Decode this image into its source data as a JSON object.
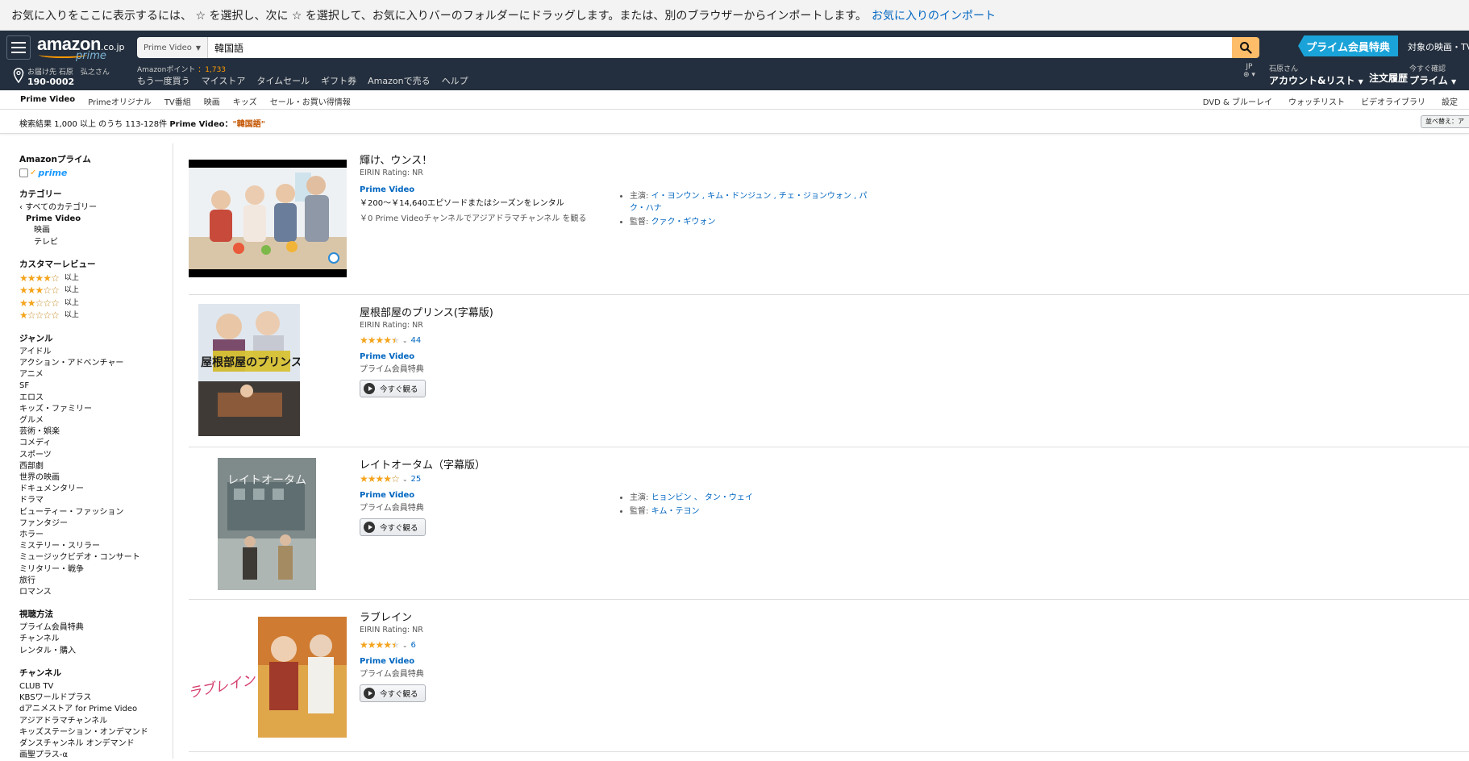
{
  "favorites_bar": {
    "message": "お気に入りをここに表示するには、 ☆ を選択し、次に ☆ を選択して、お気に入りバーのフォルダーにドラッグします。または、別のブラウザーからインポートします。",
    "import_link": "お気に入りのインポート"
  },
  "header": {
    "logo_text": "amazon",
    "logo_suffix": ".co.jp",
    "logo_prime": "prime",
    "search_category": "Prime Video",
    "search_value": "韓国語",
    "prime_banner": "プライム会員特典",
    "prime_banner_text": "対象の映画・TV",
    "deliver_line1": "お届け先 石原　弘之さん",
    "deliver_line2": "190-0002",
    "points_label": "Amazonポイント",
    "points_value": "：1,733",
    "nav_links": [
      "もう一度買う",
      "マイストア",
      "タイムセール",
      "ギフト券",
      "Amazonで売る",
      "ヘルプ"
    ],
    "lang": "JP",
    "account_line1": "石原さん",
    "account_line2": "アカウント&リスト",
    "orders": "注文履歴",
    "prime_line1": "今すぐ確認",
    "prime_line2": "プライム"
  },
  "subnav": {
    "left": [
      "Prime Video",
      "Primeオリジナル",
      "TV番組",
      "映画",
      "キッズ",
      "セール・お買い得情報"
    ],
    "right": [
      "DVD & ブルーレイ",
      "ウォッチリスト",
      "ビデオライブラリ",
      "設定"
    ]
  },
  "results_bar": {
    "prefix": "検索結果 1,000 以上 のうち 113-128件",
    "category": "Prime Video",
    "sep": "：",
    "query": "\"韓国語\"",
    "sort_label": "並べ替え：ア"
  },
  "sidebar": {
    "prime_head": "Amazonプライム",
    "prime_logo": "prime",
    "category_head": "カテゴリー",
    "all_categories": "すべてのカテゴリー",
    "prime_video": "Prime Video",
    "movie": "映画",
    "tv": "テレビ",
    "review_head": "カスタマーレビュー",
    "review_suffix": "以上",
    "review_levels": [
      4,
      3,
      2,
      1
    ],
    "genre_head": "ジャンル",
    "genres": [
      "アイドル",
      "アクション・アドベンチャー",
      "アニメ",
      "SF",
      "エロス",
      "キッズ・ファミリー",
      "グルメ",
      "芸術・娯楽",
      "コメディ",
      "スポーツ",
      "西部劇",
      "世界の映画",
      "ドキュメンタリー",
      "ドラマ",
      "ビューティー・ファッション",
      "ファンタジー",
      "ホラー",
      "ミステリー・スリラー",
      "ミュージックビデオ・コンサート",
      "ミリタリー・戦争",
      "旅行",
      "ロマンス"
    ],
    "viewing_head": "視聴方法",
    "viewing": [
      "プライム会員特典",
      "チャンネル",
      "レンタル・購入"
    ],
    "channel_head": "チャンネル",
    "channels": [
      "CLUB TV",
      "KBSワールドプラス",
      "dアニメストア for Prime Video",
      "アジアドラマチャンネル",
      "キッズステーション・オンデマンド",
      "ダンスチャンネル オンデマンド",
      "画聖プラス-α"
    ]
  },
  "results": [
    {
      "title": "輝け、ウンス！",
      "rating_label": "EIRIN Rating: NR",
      "pv": "Prime Video",
      "rent": "￥200～￥14,640エピソードまたはシーズンをレンタル",
      "channel": "￥0 Prime Videoチャンネルでアジアドラマチャンネル を観る",
      "cast_label": "主演: ",
      "cast": "イ・ヨンウン , キム・ドンジュン , チェ・ジョンウォン , パク・ハナ",
      "director_label": "監督: ",
      "director": "クァク・ギウォン"
    },
    {
      "title": "屋根部屋のプリンス(字幕版)",
      "rating_label": "EIRIN Rating: NR",
      "stars": 4.5,
      "count": "44",
      "pv": "Prime Video",
      "member": "プライム会員特典",
      "watch": "今すぐ観る",
      "poster_text": "屋根部屋のプリンス"
    },
    {
      "title": "レイトオータム（字幕版）",
      "stars": 4,
      "count": "25",
      "pv": "Prime Video",
      "member": "プライム会員特典",
      "watch": "今すぐ観る",
      "cast_label": "主演: ",
      "cast": "ヒョンビン 、 タン・ウェイ",
      "director_label": "監督: ",
      "director": "キム・テヨン",
      "poster_text": "レイトオータム"
    },
    {
      "title": "ラブレイン",
      "rating_label": "EIRIN Rating: NR",
      "stars": 4.5,
      "count": "6",
      "pv": "Prime Video",
      "member": "プライム会員特典",
      "watch": "今すぐ観る",
      "poster_text": "ラブレイン"
    }
  ],
  "colors": {
    "nav_bg": "#232f3e",
    "link": "#0066c0",
    "star": "#f4a41c",
    "search_btn": "#febd69",
    "prime_blue": "#1aa3d8"
  }
}
